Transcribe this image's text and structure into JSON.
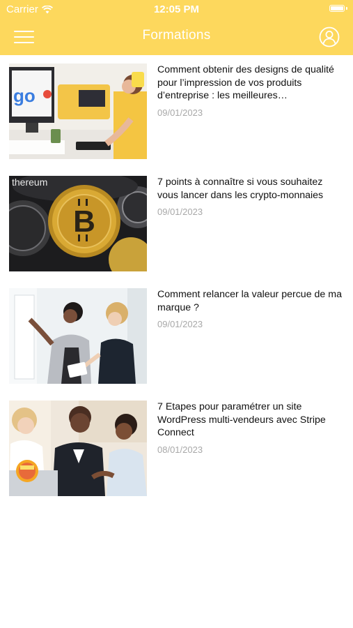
{
  "status_bar": {
    "carrier": "Carrier",
    "time": "12:05 PM"
  },
  "nav": {
    "title": "Formations",
    "menu_icon": "hamburger-menu-icon",
    "profile_icon": "user-profile-icon"
  },
  "colors": {
    "accent": "#fdd85d",
    "date_text": "#a8a8a8"
  },
  "articles": [
    {
      "title": "Comment obtenir des designs de qualité pour l’impression de vos produits d’entreprise : les meilleures…",
      "date": "09/01/2023"
    },
    {
      "title": "7 points à connaître si vous souhaitez vous lancer dans les crypto-monnaies",
      "date": "09/01/2023"
    },
    {
      "title": "Comment relancer la valeur percue de ma marque ?",
      "date": "09/01/2023"
    },
    {
      "title": "7 Etapes pour paramétrer un site WordPress multi-vendeurs avec Stripe Connect",
      "date": "08/01/2023"
    }
  ]
}
